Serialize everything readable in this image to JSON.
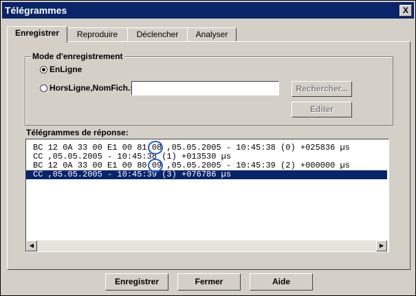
{
  "window": {
    "title": "Télégrammes",
    "close_glyph": "X"
  },
  "tabs": [
    {
      "label": "Enregistrer",
      "active": true
    },
    {
      "label": "Reproduire",
      "active": false
    },
    {
      "label": "Déclencher",
      "active": false
    },
    {
      "label": "Analyser",
      "active": false
    }
  ],
  "mode_group": {
    "label": "Mode d'enregistrement",
    "online_label": "EnLigne",
    "offline_label": "HorsLigne,NomFich.:",
    "selected": "online",
    "filename_value": "",
    "browse_label": "Rechercher...",
    "edit_label": "Editer"
  },
  "responses": {
    "label": "Télégrammes de réponse:",
    "lines": [
      "BC 12 0A 33 00 E1 00 81 08 ,05.05.2005 - 10:45:38 (0) +025836 µs",
      "CC ,05.05.2005 - 10:45:38 (1) +013530 µs",
      "BC 12 0A 33 00 E1 00 80 09 ,05.05.2005 - 10:45:39 (2) +000000 µs",
      "CC ,05.05.2005 - 10:45:39 (3) +076786 µs"
    ],
    "selected_index": 3
  },
  "buttons": {
    "record": "Enregistrer",
    "close": "Fermer",
    "help": "Aide"
  },
  "colors": {
    "titlebar": "#0a246a",
    "selection": "#0a246a",
    "annotation_circle": "#1f5bd8",
    "face": "#d4d0c8"
  }
}
